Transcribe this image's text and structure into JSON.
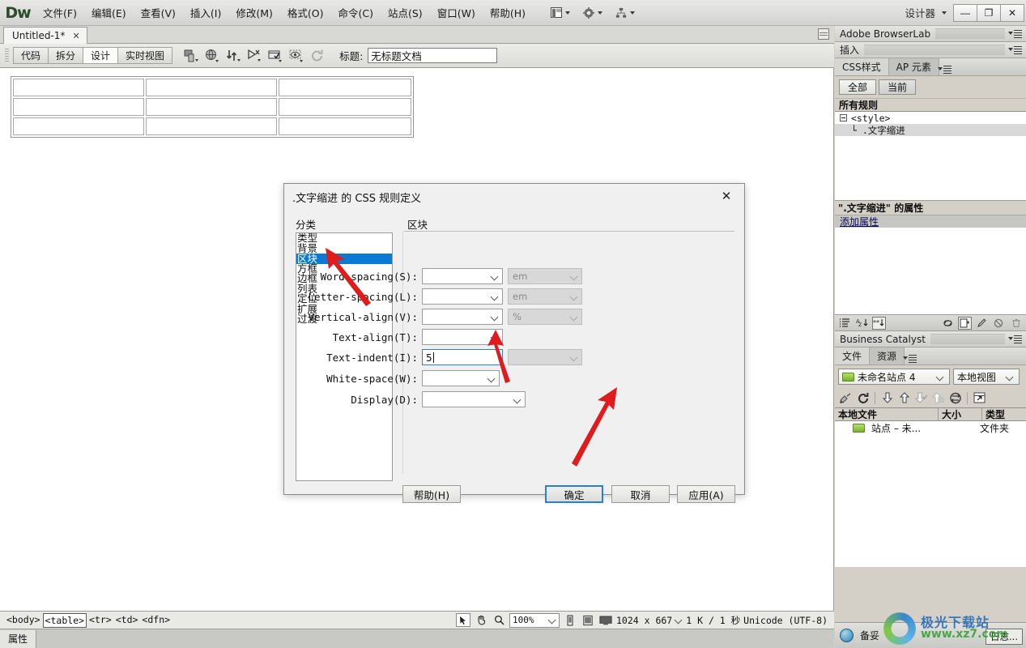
{
  "titlebar": {
    "logo": "Dw",
    "menus": [
      "文件(F)",
      "编辑(E)",
      "查看(V)",
      "插入(I)",
      "修改(M)",
      "格式(O)",
      "命令(C)",
      "站点(S)",
      "窗口(W)",
      "帮助(H)"
    ],
    "workspace": "设计器",
    "minimize": "—",
    "maximize": "❐",
    "close": "✕"
  },
  "doc": {
    "tab_label": "Untitled-1*",
    "tab_close": "✕",
    "view_buttons": [
      "代码",
      "拆分",
      "设计",
      "实时视图"
    ],
    "active_view": "设计",
    "title_label": "标题:",
    "title_value": "无标题文档"
  },
  "statusbar": {
    "tags": [
      "<body>",
      "<table>",
      "<tr>",
      "<td>",
      "<dfn>"
    ],
    "selected_tag": "<table>",
    "zoom": "100%",
    "window_size": "1024 x 667",
    "download": "1 K / 1 秒",
    "encoding": "Unicode (UTF-8)",
    "props_tab": "属性"
  },
  "dialog": {
    "title": ".文字缩进 的 CSS 规则定义",
    "close": "✕",
    "category_label": "分类",
    "categories": [
      "类型",
      "背景",
      "区块",
      "方框",
      "边框",
      "列表",
      "定位",
      "扩展",
      "过渡"
    ],
    "selected_category": "区块",
    "section_label": "区块",
    "fields": [
      {
        "label": "Word-spacing(S):",
        "value": "",
        "unit": "em",
        "unit_disabled": true,
        "type": "select"
      },
      {
        "label": "Letter-spacing(L):",
        "value": "",
        "unit": "em",
        "unit_disabled": true,
        "type": "select"
      },
      {
        "label": "Vertical-align(V):",
        "value": "",
        "unit": "%",
        "unit_disabled": true,
        "type": "select"
      },
      {
        "label": "Text-align(T):",
        "value": "",
        "unit": "",
        "unit_disabled": false,
        "type": "select"
      },
      {
        "label": "Text-indent(I):",
        "value": "5",
        "unit": "",
        "unit_disabled": true,
        "type": "text"
      },
      {
        "label": "White-space(W):",
        "value": "",
        "unit": "",
        "unit_disabled": false,
        "type": "select"
      },
      {
        "label": "Display(D):",
        "value": "",
        "unit": "",
        "unit_disabled": false,
        "type": "select"
      }
    ],
    "buttons": {
      "help": "帮助(H)",
      "ok": "确定",
      "cancel": "取消",
      "apply": "应用(A)"
    }
  },
  "panels": {
    "browserlab": "Adobe BrowserLab",
    "insert": "插入",
    "css_tabs": [
      "CSS样式",
      "AP 元素"
    ],
    "css_active": "CSS样式",
    "scope_buttons": [
      "全部",
      "当前"
    ],
    "scope_active": "全部",
    "all_rules_header": "所有规则",
    "rules": [
      "<style>",
      "└ .文字缩进"
    ],
    "selected_rule": "└ .文字缩进",
    "properties_header": "\".文字缩进\" 的属性",
    "add_property": "添加属性",
    "business_catalyst": "Business Catalyst",
    "file_tabs": [
      "文件",
      "资源"
    ],
    "file_active": "文件",
    "site_select": "未命名站点 4",
    "view_select": "本地视图",
    "file_columns": [
      "本地文件",
      "大小",
      "类型"
    ],
    "file_rows": [
      {
        "name": "站点 – 未...",
        "size": "",
        "type": "文件夹"
      }
    ],
    "status_ready": "备妥",
    "log_button": "日志..."
  },
  "watermark": {
    "line1": "极光下载站",
    "line2": "www.xz7.com"
  }
}
